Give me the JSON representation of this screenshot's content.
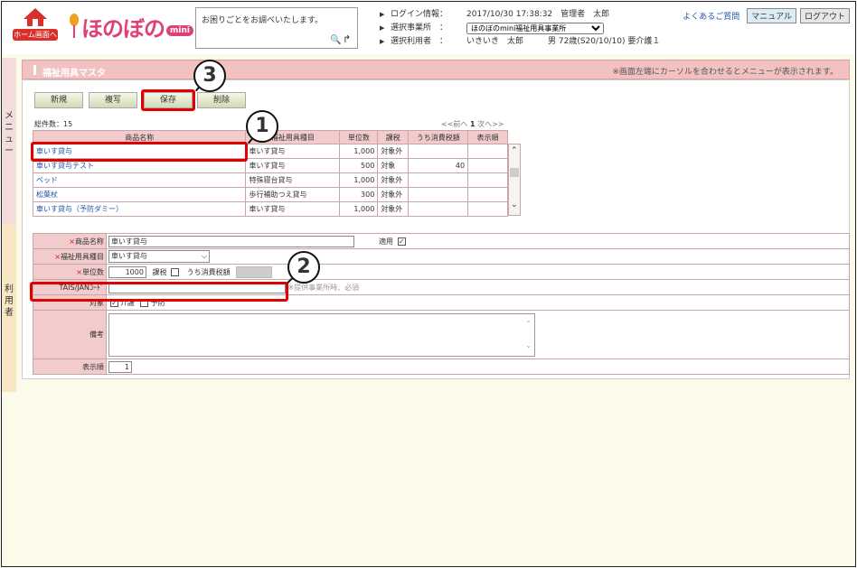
{
  "header": {
    "home_label": "ホーム画面へ",
    "logo_text": "ほのぼの",
    "logo_badge": "mini",
    "help_text": "お困りごとをお調べいたします。",
    "login_label": "ログイン情報：",
    "login_value": "2017/10/30 17:38:32　管理者　太郎",
    "office_label": "選択事業所　：",
    "office_value": "ほのぼのmini福祉用具事業所",
    "user_label": "選択利用者　：",
    "user_value": "いきいき　太郎　　　男 72歳(S20/10/10) 要介護１",
    "faq": "よくあるご質問",
    "manual": "マニュアル",
    "logout": "ログアウト"
  },
  "sidebar": {
    "menu": "メニュー",
    "user": "利用者"
  },
  "page": {
    "title": "福祉用具マスタ",
    "note": "※画面左端にカーソルを合わせるとメニューが表示されます。"
  },
  "toolbar": {
    "new": "新規",
    "copy": "複写",
    "save": "保存",
    "delete": "削除"
  },
  "list": {
    "total": "総件数：15",
    "pager_prev": "<<前へ",
    "pager_page": "1",
    "pager_next": "次へ>>",
    "headers": [
      "商品名称",
      "福祉用具種目",
      "単位数",
      "課税",
      "うち消費税額",
      "表示順"
    ],
    "rows": [
      [
        "車いす貸与",
        "車いす貸与",
        "1,000",
        "対象外",
        "",
        ""
      ],
      [
        "車いす貸与テスト",
        "車いす貸与",
        "500",
        "対象",
        "40",
        ""
      ],
      [
        "ベッド",
        "特殊寝台貸与",
        "1,000",
        "対象外",
        "",
        ""
      ],
      [
        "松葉杖",
        "歩行補助つえ貸与",
        "300",
        "対象外",
        "",
        ""
      ],
      [
        "車いす貸与（予防ダミー）",
        "車いす貸与",
        "1,000",
        "対象外",
        "",
        ""
      ]
    ]
  },
  "form": {
    "product_name_label": "商品名称",
    "product_name_value": "車いす貸与",
    "apply_label": "適用",
    "category_label": "福祉用具種目",
    "category_value": "車いす貸与",
    "units_label": "単位数",
    "units_value": "1000",
    "tax_label": "課税",
    "tax_included_label": "うち消費税額",
    "code_label": "TAIS/JANｺｰﾄﾞ",
    "code_hint": "※提供事業所時、必須",
    "target_label": "対象",
    "target_care": "介護",
    "target_prevent": "予防",
    "remarks_label": "備考",
    "order_label": "表示順",
    "order_value": "1",
    "required_mark": "×"
  },
  "annotations": {
    "one": "1",
    "two": "2",
    "three": "3"
  },
  "colors": {
    "title_bar": "#f2c2c2",
    "header_cell": "#f2cccc",
    "highlight": "#e00000",
    "link": "#2255aa"
  }
}
